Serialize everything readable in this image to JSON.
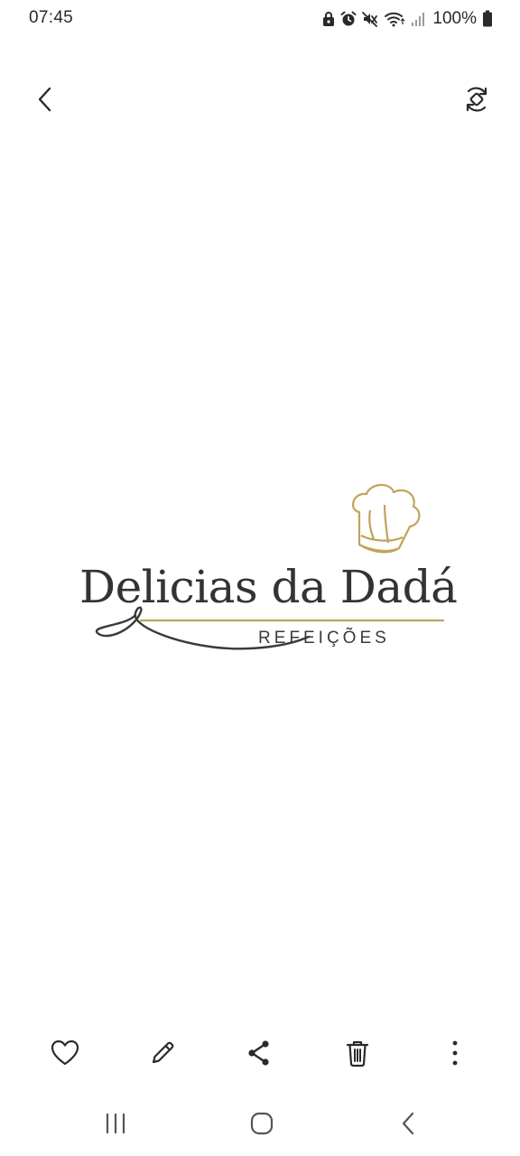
{
  "status_bar": {
    "time": "07:45",
    "battery": "100%",
    "icons": [
      "lock-icon",
      "alarm-icon",
      "mute-icon",
      "wifi-icon",
      "signal-icon",
      "battery-icon"
    ]
  },
  "top_bar": {
    "back_icon": "chevron-left-icon",
    "rotate_icon": "rotate-icon"
  },
  "logo": {
    "title": "Delicias da Dadá",
    "subtitle": "REFEIÇÕES",
    "accent_color": "#c2a35a",
    "text_color": "#333333"
  },
  "action_bar": {
    "items": [
      "favorite-icon",
      "edit-icon",
      "share-icon",
      "delete-icon",
      "more-icon"
    ]
  },
  "nav_bar": {
    "items": [
      "recent-apps-icon",
      "home-icon",
      "back-icon"
    ]
  }
}
